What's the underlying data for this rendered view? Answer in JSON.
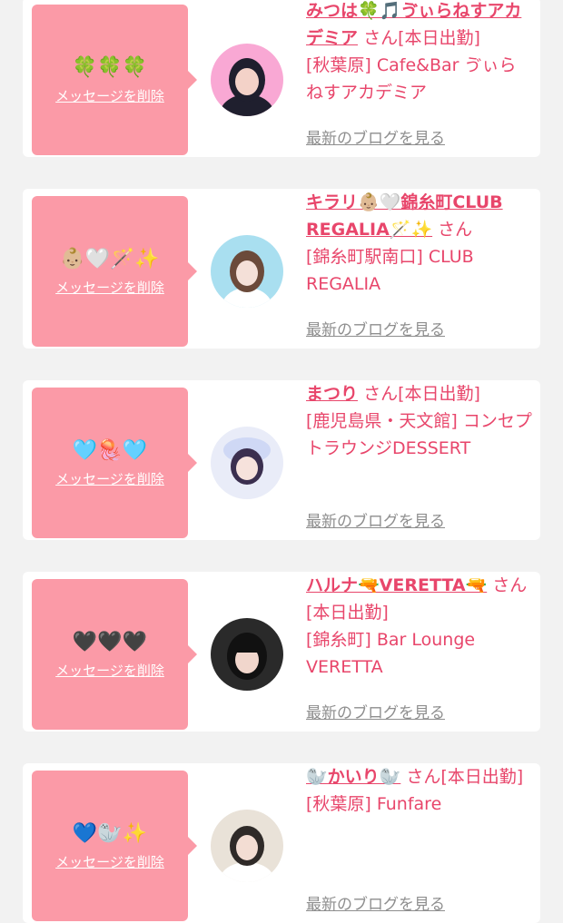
{
  "items": [
    {
      "name": "みつは🍀🎵ゔぃらねすアカデミア",
      "suffix": "さん[本日出勤]",
      "shop": "[秋葉原] Cafe&Bar ゔぃらねすアカデミア",
      "emoji": "🍀🍀🍀",
      "delete_label": "メッセージを削除",
      "blog_label": "最新のブログを見る",
      "avatar_colors": [
        "#f9a8d4",
        "#1f1f2e",
        "#f3d2c8"
      ]
    },
    {
      "name": "キラリ👶🏼🤍錦糸町CLUB REGALIA🪄✨",
      "suffix": "さん",
      "shop": "[錦糸町駅南口] CLUB REGALIA",
      "emoji": "👶🏼🤍🪄✨",
      "delete_label": "メッセージを削除",
      "blog_label": "最新のブログを見る",
      "avatar_colors": [
        "#a9dff0",
        "#6b4a3a",
        "#f4e0d8"
      ]
    },
    {
      "name": "まつり",
      "suffix": "さん[本日出勤]",
      "shop": "[鹿児島県・天文館] コンセプトラウンジDESSERT",
      "emoji": "🩵🪼🩵",
      "delete_label": "メッセージを削除",
      "blog_label": "最新のブログを見る",
      "avatar_colors": [
        "#cfd8f5",
        "#e9ecf8",
        "#3b2f4f"
      ]
    },
    {
      "name": "ハルナ🔫VERETTA🔫",
      "suffix": "さん[本日出勤]",
      "shop": "[錦糸町] Bar Lounge VERETTA",
      "emoji": "🖤🖤🖤",
      "delete_label": "メッセージを削除",
      "blog_label": "最新のブログを見る",
      "avatar_colors": [
        "#2a2a2a",
        "#111111",
        "#f1d6cc"
      ]
    },
    {
      "name": "🦭かいり🦭",
      "suffix": "さん[本日出勤]",
      "shop": "[秋葉原] Funfare",
      "emoji": "💙🦭✨",
      "delete_label": "メッセージを削除",
      "blog_label": "最新のブログを見る",
      "avatar_colors": [
        "#e9e2d8",
        "#2f2a28",
        "#f3ddd3"
      ]
    }
  ]
}
